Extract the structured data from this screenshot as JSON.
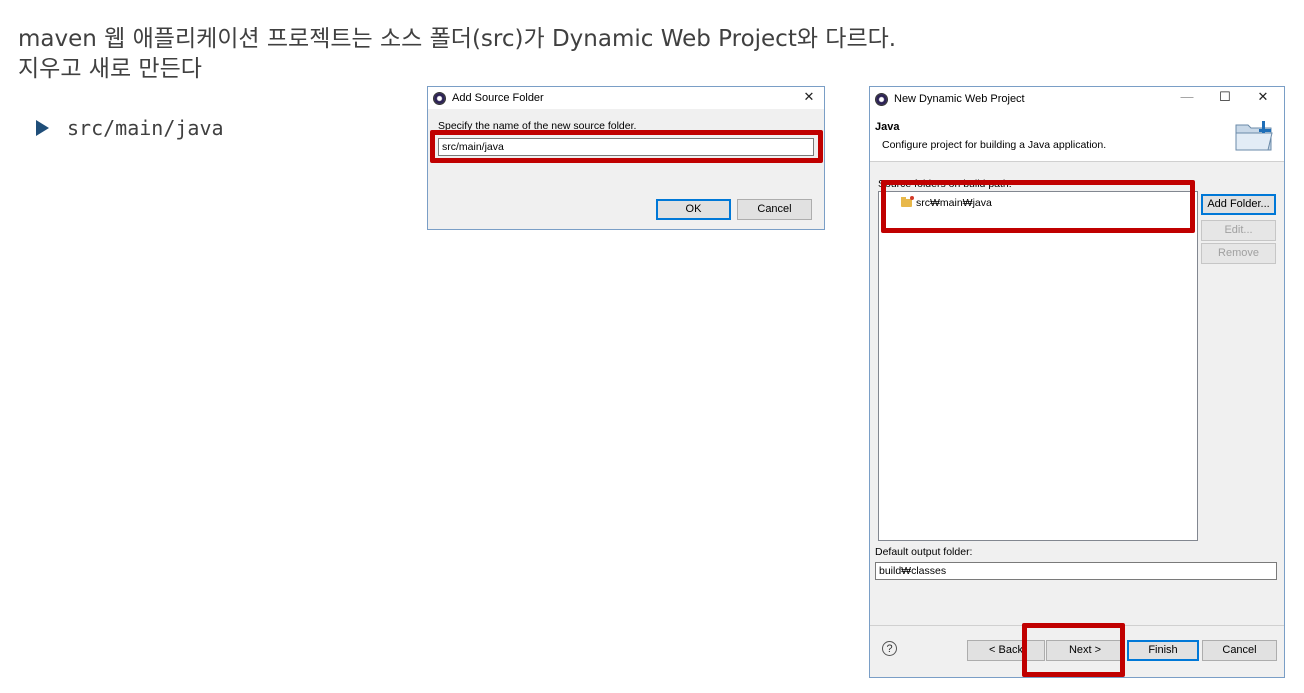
{
  "slide": {
    "title_line1": "maven 웹 애플리케이션 프로젝트는 소스 폴더(src)가 Dynamic Web Project와 다르다.",
    "title_line2": "지우고 새로 만든다",
    "bullet": "src/main/java"
  },
  "add_source_dialog": {
    "title": "Add Source Folder",
    "close_glyph": "✕",
    "prompt": "Specify the name of the new source folder.",
    "folder_value": "src/main/java",
    "ok_label": "OK",
    "cancel_label": "Cancel"
  },
  "web_project_dialog": {
    "title": "New Dynamic Web Project",
    "minimize_glyph": "—",
    "maximize_glyph": "☐",
    "close_glyph": "✕",
    "section_title": "Java",
    "section_desc": "Configure project for building a Java application.",
    "source_list_label": "Source folders on build path:",
    "source_items": [
      "src₩main₩java"
    ],
    "add_folder_label": "Add Folder...",
    "edit_label": "Edit...",
    "remove_label": "Remove",
    "output_label": "Default output folder:",
    "output_value": "build₩classes",
    "help_glyph": "?",
    "back_label": "< Back",
    "next_label": "Next >",
    "finish_label": "Finish",
    "cancel_label": "Cancel"
  },
  "colors": {
    "highlight": "#c00000",
    "dialog_bg": "#f0f0f0",
    "bullet_arrow": "#1f4e79"
  }
}
